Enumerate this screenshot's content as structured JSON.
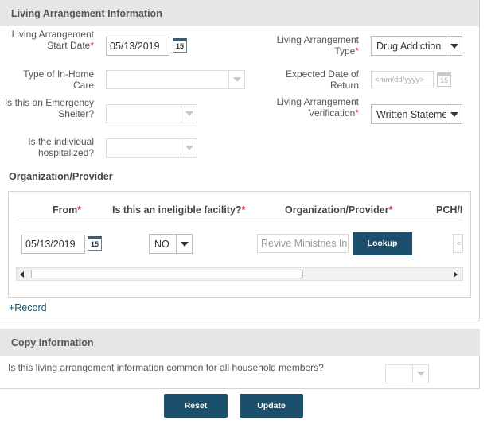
{
  "living_section": {
    "title": "Living Arrangement Information",
    "start_date_label": "Living Arrangement Start Date",
    "start_date_value": "05/13/2019",
    "type_label": "Living Arrangement Type",
    "type_value": "Drug Addiction",
    "inhome_label": "Type of In-Home Care",
    "expected_return_label": "Expected Date of Return",
    "expected_return_placeholder": "<mm/dd/yyyy>",
    "emergency_label": "Is this an Emergency Shelter?",
    "verification_label": "Living Arrangement Verification",
    "verification_value": "Written Statement",
    "hospitalized_label": "Is the individual hospitalized?"
  },
  "org_section": {
    "title": "Organization/Provider",
    "columns": {
      "from": "From",
      "ineligible": "Is this an ineligible facility?",
      "org": "Organization/Provider",
      "pch": "PCH/I"
    },
    "row": {
      "from_value": "05/13/2019",
      "ineligible_value": "NO",
      "org_value": "Revive Ministries Inc",
      "lookup_label": "Lookup",
      "pch_value": "<"
    },
    "add_record": "+Record"
  },
  "copy_section": {
    "title": "Copy Information",
    "question": "Is this living arrangement information common for all household members?"
  },
  "buttons": {
    "reset": "Reset",
    "update": "Update"
  },
  "icons": {
    "calendar_day": "15"
  },
  "colors": {
    "accent": "#1c4f6b",
    "required": "#cc2b2b",
    "header_bg": "#e6e6e6"
  }
}
